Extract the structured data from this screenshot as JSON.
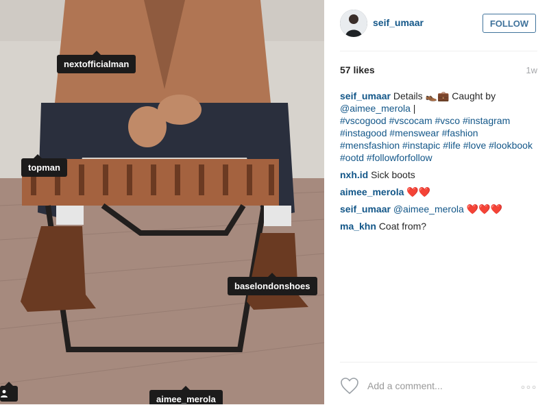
{
  "photo": {
    "tags": [
      {
        "label": "nextofficialman"
      },
      {
        "label": "topman"
      },
      {
        "label": "baselondonshoes"
      },
      {
        "label": "aimee_merola"
      }
    ],
    "user_badge_icon": "person-icon"
  },
  "header": {
    "username": "seif_umaar",
    "follow_label": "FOLLOW"
  },
  "stats": {
    "likes": "57 likes",
    "time_ago": "1w"
  },
  "caption": {
    "user": "seif_umaar",
    "text": "Details 👞💼 Caught by",
    "mention": "@aimee_merola",
    "after_mention": " |",
    "hashtags": "#vscogood #vscocam #vsco #instagram #instagood #menswear #fashion #mensfashion #instapic #life #love #lookbook #ootd #followforfollow"
  },
  "comments": [
    {
      "user": "nxh.id",
      "text": "Sick boots"
    },
    {
      "user": "aimee_merola",
      "text": "❤️❤️"
    },
    {
      "user": "seif_umaar",
      "mention": "@aimee_merola",
      "text": " ❤️❤️❤️"
    },
    {
      "user": "ma_khn",
      "text": "Coat from?"
    }
  ],
  "footer": {
    "like_icon": "heart-icon",
    "comment_placeholder": "Add a comment...",
    "more_icon": "more-options-icon",
    "more_label": "○○○"
  },
  "colors": {
    "link": "#125688",
    "follow_border": "#3f729b",
    "tag_bg": "#1c1b1b"
  }
}
